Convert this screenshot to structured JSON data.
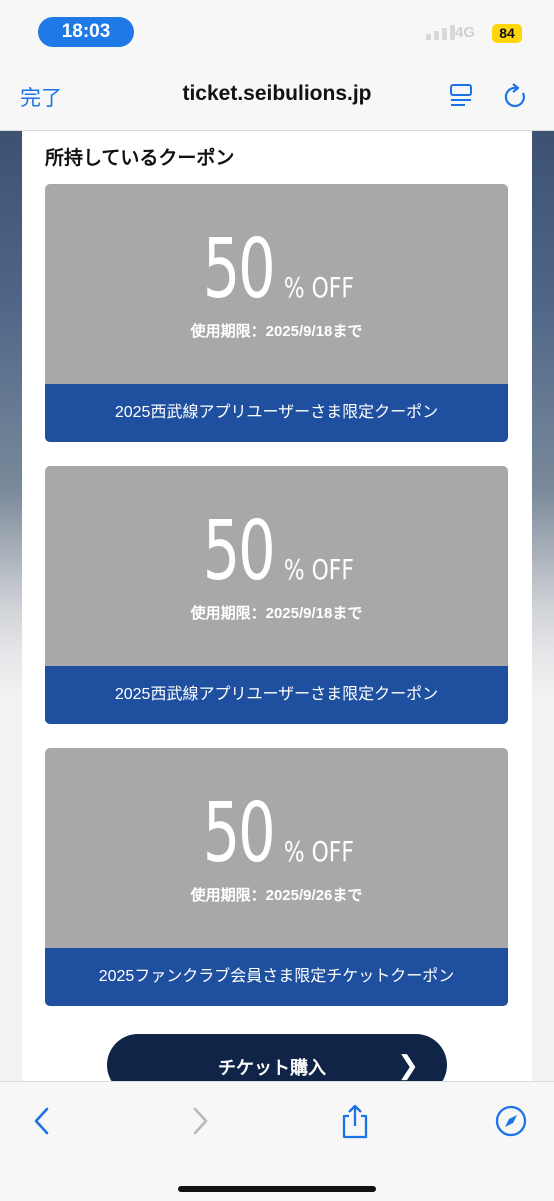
{
  "status_bar": {
    "time": "18:03",
    "network": "4G",
    "battery": "84"
  },
  "browser": {
    "done_label": "完了",
    "url": "ticket.seibulions.jp"
  },
  "page": {
    "section_title": "所持しているクーポン",
    "coupons": [
      {
        "discount_number": "50",
        "discount_unit": "% OFF",
        "expiry": "使用期限：2025/9/18まで",
        "name": "2025西武線アプリユーザーさま限定クーポン"
      },
      {
        "discount_number": "50",
        "discount_unit": "% OFF",
        "expiry": "使用期限：2025/9/18まで",
        "name": "2025西武線アプリユーザーさま限定クーポン"
      },
      {
        "discount_number": "50",
        "discount_unit": "% OFF",
        "expiry": "使用期限：2025/9/26まで",
        "name": "2025ファンクラブ会員さま限定チケットクーポン"
      }
    ],
    "purchase_button": "チケット購入",
    "purchase_chevron": "❯"
  },
  "toolbar": {
    "icons": [
      "back-icon",
      "forward-icon",
      "share-icon",
      "compass-icon"
    ]
  },
  "colors": {
    "accent": "#1a73e8",
    "coupon_band": "#1f50a0",
    "coupon_bg": "#a8a8a8",
    "button": "#0f2447"
  }
}
